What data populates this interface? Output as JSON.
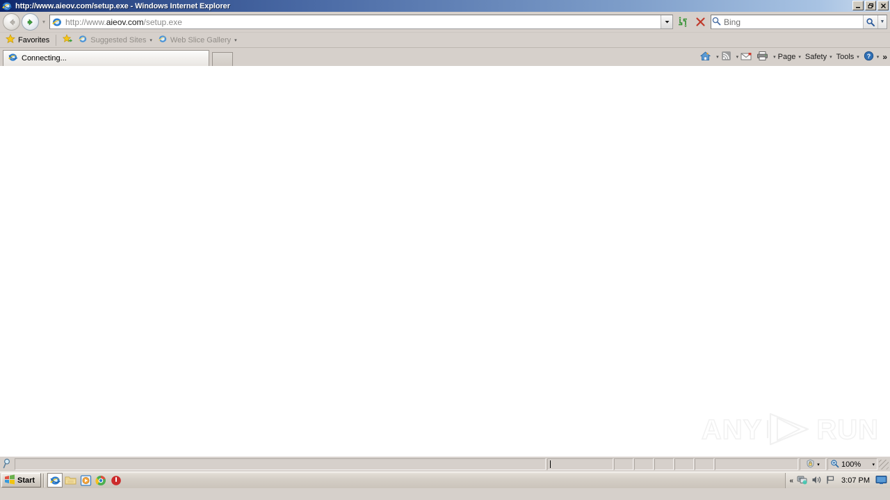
{
  "window": {
    "title": "http://www.aieov.com/setup.exe - Windows Internet Explorer",
    "app_icon": "internet-explorer-icon",
    "minimize_label": "_",
    "maximize_label": "❐",
    "close_label": "✕"
  },
  "navigation": {
    "back_label": "Back",
    "forward_label": "Forward",
    "recent_pages_label": "▾"
  },
  "address": {
    "favicon": "internet-explorer-icon",
    "scheme": "http://www.",
    "domain": "aieov.com",
    "path": "/setup.exe",
    "full_url": "http://www.aieov.com/setup.exe",
    "dropdown_label": "▼",
    "refresh_label": "Refresh",
    "stop_label": "Stop"
  },
  "search": {
    "placeholder": "Bing",
    "go_label": "Search",
    "dropdown_label": "▼"
  },
  "favorites_bar": {
    "favorites_label": "Favorites",
    "items": [
      {
        "label": "Suggested Sites",
        "icon": "internet-explorer-icon",
        "chevron": "▾"
      },
      {
        "label": "Web Slice Gallery",
        "icon": "internet-explorer-icon",
        "chevron": "▾"
      }
    ]
  },
  "tabs": {
    "active": {
      "label": "Connecting...",
      "icon": "internet-explorer-icon"
    },
    "new_tab_label": ""
  },
  "command_bar": {
    "home_icon": "home-icon",
    "feeds_icon": "rss-feed-icon",
    "mail_icon": "mail-icon",
    "print_icon": "printer-icon",
    "menus": [
      {
        "label": "Page",
        "chevron": "▾"
      },
      {
        "label": "Safety",
        "chevron": "▾"
      },
      {
        "label": "Tools",
        "chevron": "▾"
      }
    ],
    "help_icon": "help-icon",
    "help_chevron": "▾",
    "overflow_label": "»"
  },
  "content": {
    "page_text": "",
    "watermark_left": "ANY",
    "watermark_right": "RUN"
  },
  "status_bar": {
    "status_text": "",
    "search_icon": "magnifier-icon",
    "zones": [
      "",
      "",
      "",
      "",
      "",
      ""
    ],
    "security_icon": "security-zone-icon",
    "security_chevron": "▾",
    "zoom_icon": "zoom-in-icon",
    "zoom_level": "100%",
    "zoom_chevron": "▾"
  },
  "taskbar": {
    "start_label": "Start",
    "quick_launch": [
      {
        "name": "internet-explorer",
        "active": true
      },
      {
        "name": "file-explorer",
        "active": false
      },
      {
        "name": "media-player",
        "active": false
      },
      {
        "name": "google-chrome",
        "active": false
      },
      {
        "name": "shutdown-app",
        "active": false
      }
    ],
    "tray": {
      "expand_label": "«",
      "network_icon": "network-icon",
      "volume_icon": "volume-icon",
      "security_flag_icon": "security-flag-icon",
      "time": "3:07 PM",
      "desktop_icon": "show-desktop-icon"
    }
  }
}
